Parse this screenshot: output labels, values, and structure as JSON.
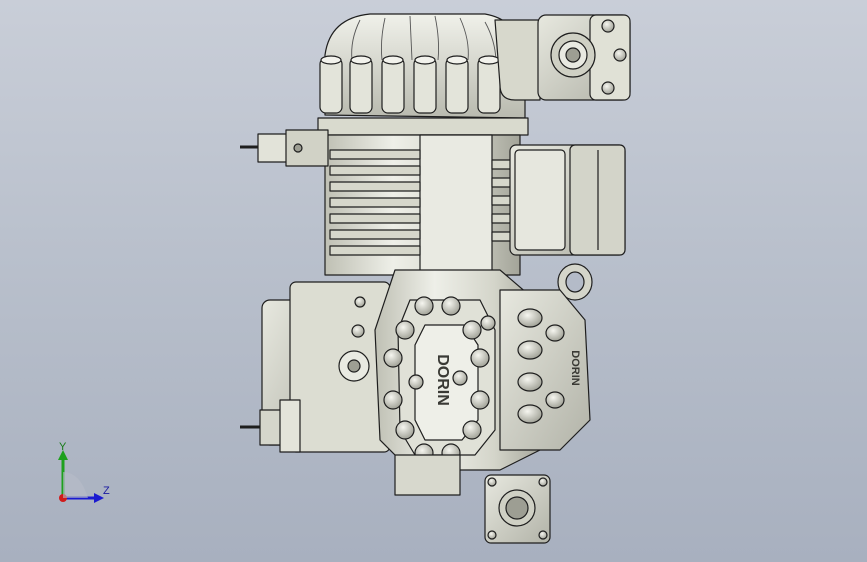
{
  "viewport": {
    "background_top": "#c9ced8",
    "background_bottom": "#a8b0bf"
  },
  "model": {
    "name": "",
    "shade_light": "#e9eae2",
    "shade_mid": "#cfd0c4",
    "shade_dark": "#8f9086",
    "outline": "#1e1e1e",
    "cover_lettering": "DORIN",
    "side_lettering": "DORIN"
  },
  "triad": {
    "y_label": "Y",
    "z_label": "Z",
    "y_color": "#1ea01e",
    "z_color": "#1a1ad0",
    "x_color": "#d01a1a"
  }
}
